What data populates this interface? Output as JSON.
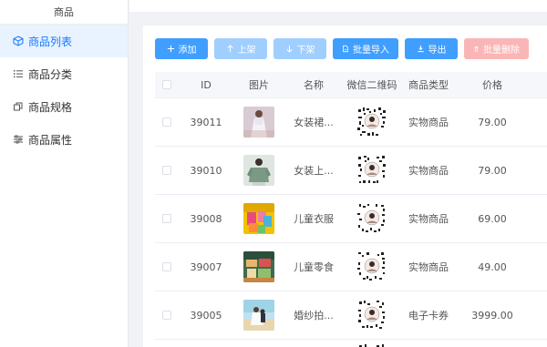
{
  "sidebar": {
    "header": "商品",
    "items": [
      {
        "label": "商品列表",
        "icon": "box-icon",
        "active": true
      },
      {
        "label": "商品分类",
        "icon": "list-icon",
        "active": false
      },
      {
        "label": "商品规格",
        "icon": "copy-icon",
        "active": false
      },
      {
        "label": "商品属性",
        "icon": "sliders-icon",
        "active": false
      }
    ]
  },
  "toolbar": {
    "add": "添加",
    "up": "上架",
    "down": "下架",
    "import": "批量导入",
    "export": "导出",
    "delete": "批量删除"
  },
  "table": {
    "headers": {
      "id": "ID",
      "image": "图片",
      "name": "名称",
      "qr": "微信二维码",
      "type": "商品类型",
      "price": "价格"
    },
    "rows": [
      {
        "id": "39011",
        "name": "女装裙...",
        "type": "实物商品",
        "price": "79.00",
        "thumb": "dress"
      },
      {
        "id": "39010",
        "name": "女装上...",
        "type": "实物商品",
        "price": "79.00",
        "thumb": "top"
      },
      {
        "id": "39008",
        "name": "儿童衣服",
        "type": "实物商品",
        "price": "69.00",
        "thumb": "kids-clothes"
      },
      {
        "id": "39007",
        "name": "儿童零食",
        "type": "实物商品",
        "price": "49.00",
        "thumb": "snacks"
      },
      {
        "id": "39005",
        "name": "婚纱拍...",
        "type": "电子卡券",
        "price": "3999.00",
        "thumb": "wedding"
      }
    ]
  },
  "colors": {
    "primary": "#409eff",
    "primary_disabled": "#a0cfff",
    "danger_disabled": "#fab6b6",
    "active_bg": "#e8f3ff",
    "active_text": "#1677ff"
  }
}
